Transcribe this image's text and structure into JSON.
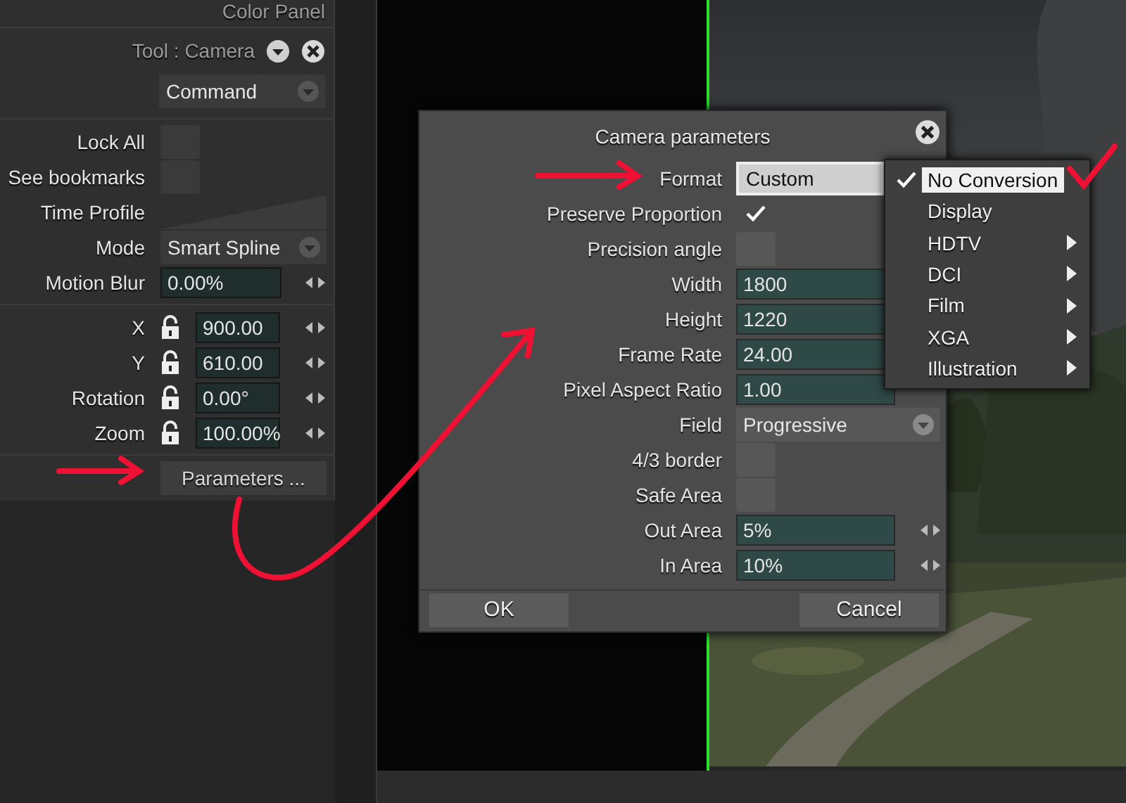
{
  "panel_header": {
    "title": "Color Panel"
  },
  "tool_panel": {
    "title": "Tool : Camera",
    "command": "Command",
    "options": [
      {
        "kind": "checkbox",
        "label": "Lock All",
        "checked": false
      },
      {
        "kind": "checkbox",
        "label": "See bookmarks",
        "checked": false
      },
      {
        "kind": "profile",
        "label": "Time Profile"
      },
      {
        "kind": "dropdown",
        "label": "Mode",
        "value": "Smart Spline"
      },
      {
        "kind": "number",
        "label": "Motion Blur",
        "value": "0.00%"
      }
    ],
    "transform": [
      {
        "label": "X",
        "locked": false,
        "value": "900.00"
      },
      {
        "label": "Y",
        "locked": false,
        "value": "610.00"
      },
      {
        "label": "Rotation",
        "locked": false,
        "value": "0.00°"
      },
      {
        "label": "Zoom",
        "locked": false,
        "value": "100.00%"
      }
    ],
    "parameters_button": "Parameters ..."
  },
  "dialog": {
    "title": "Camera parameters",
    "fields": [
      {
        "kind": "format",
        "label": "Format",
        "value": "Custom"
      },
      {
        "kind": "checkbox",
        "label": "Preserve Proportion",
        "checked": true
      },
      {
        "kind": "checkbox",
        "label": "Precision angle",
        "checked": false
      },
      {
        "kind": "number",
        "label": "Width",
        "value": "1800"
      },
      {
        "kind": "number",
        "label": "Height",
        "value": "1220"
      },
      {
        "kind": "number",
        "label": "Frame Rate",
        "value": "24.00"
      },
      {
        "kind": "number",
        "label": "Pixel Aspect Ratio",
        "value": "1.00"
      },
      {
        "kind": "dropdown",
        "label": "Field",
        "value": "Progressive"
      },
      {
        "kind": "checkbox",
        "label": "4/3 border",
        "checked": false
      },
      {
        "kind": "checkbox",
        "label": "Safe Area",
        "checked": false
      },
      {
        "kind": "stepper",
        "label": "Out Area",
        "value": "5%"
      },
      {
        "kind": "stepper",
        "label": "In Area",
        "value": "10%"
      }
    ],
    "buttons": [
      "OK",
      "Cancel"
    ]
  },
  "format_menu": {
    "items": [
      {
        "label": "No Conversion",
        "selected": true,
        "submenu": false
      },
      {
        "label": "Display",
        "selected": false,
        "submenu": false
      },
      {
        "label": "HDTV",
        "selected": false,
        "submenu": true
      },
      {
        "label": "DCI",
        "selected": false,
        "submenu": true
      },
      {
        "label": "Film",
        "selected": false,
        "submenu": true
      },
      {
        "label": "XGA",
        "selected": false,
        "submenu": true
      },
      {
        "label": "Illustration",
        "selected": false,
        "submenu": true
      }
    ]
  }
}
